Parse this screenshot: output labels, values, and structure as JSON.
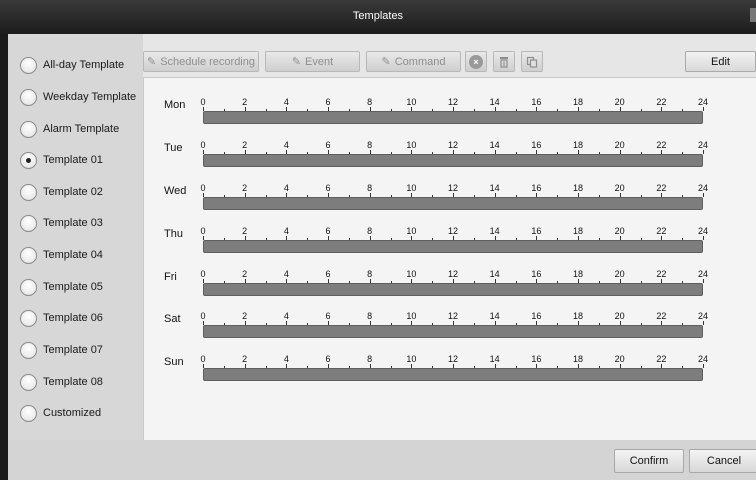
{
  "window": {
    "title": "Templates"
  },
  "templates": [
    {
      "label": "All-day Template",
      "checked": false
    },
    {
      "label": "Weekday Template",
      "checked": false
    },
    {
      "label": "Alarm Template",
      "checked": false
    },
    {
      "label": "Template 01",
      "checked": true
    },
    {
      "label": "Template 02",
      "checked": false
    },
    {
      "label": "Template 03",
      "checked": false
    },
    {
      "label": "Template 04",
      "checked": false
    },
    {
      "label": "Template 05",
      "checked": false
    },
    {
      "label": "Template 06",
      "checked": false
    },
    {
      "label": "Template 07",
      "checked": false
    },
    {
      "label": "Template 08",
      "checked": false
    },
    {
      "label": "Customized",
      "checked": false
    }
  ],
  "toolbar": {
    "schedule_recording": "Schedule recording",
    "event": "Event",
    "command": "Command",
    "edit": "Edit",
    "delete_icon": "clear-circle-icon",
    "trash_icon": "trash-icon",
    "copy_icon": "copy-icon"
  },
  "schedule": {
    "days": [
      "Mon",
      "Tue",
      "Wed",
      "Thu",
      "Fri",
      "Sat",
      "Sun"
    ],
    "hour_labels": [
      "0",
      "2",
      "4",
      "6",
      "8",
      "10",
      "12",
      "14",
      "16",
      "18",
      "20",
      "22",
      "24"
    ]
  },
  "footer": {
    "confirm": "Confirm",
    "cancel": "Cancel"
  },
  "colors": {
    "bar": "#7d7d7d",
    "titlebar": "#2a2a2a",
    "sidebar": "#d7d7d7"
  }
}
